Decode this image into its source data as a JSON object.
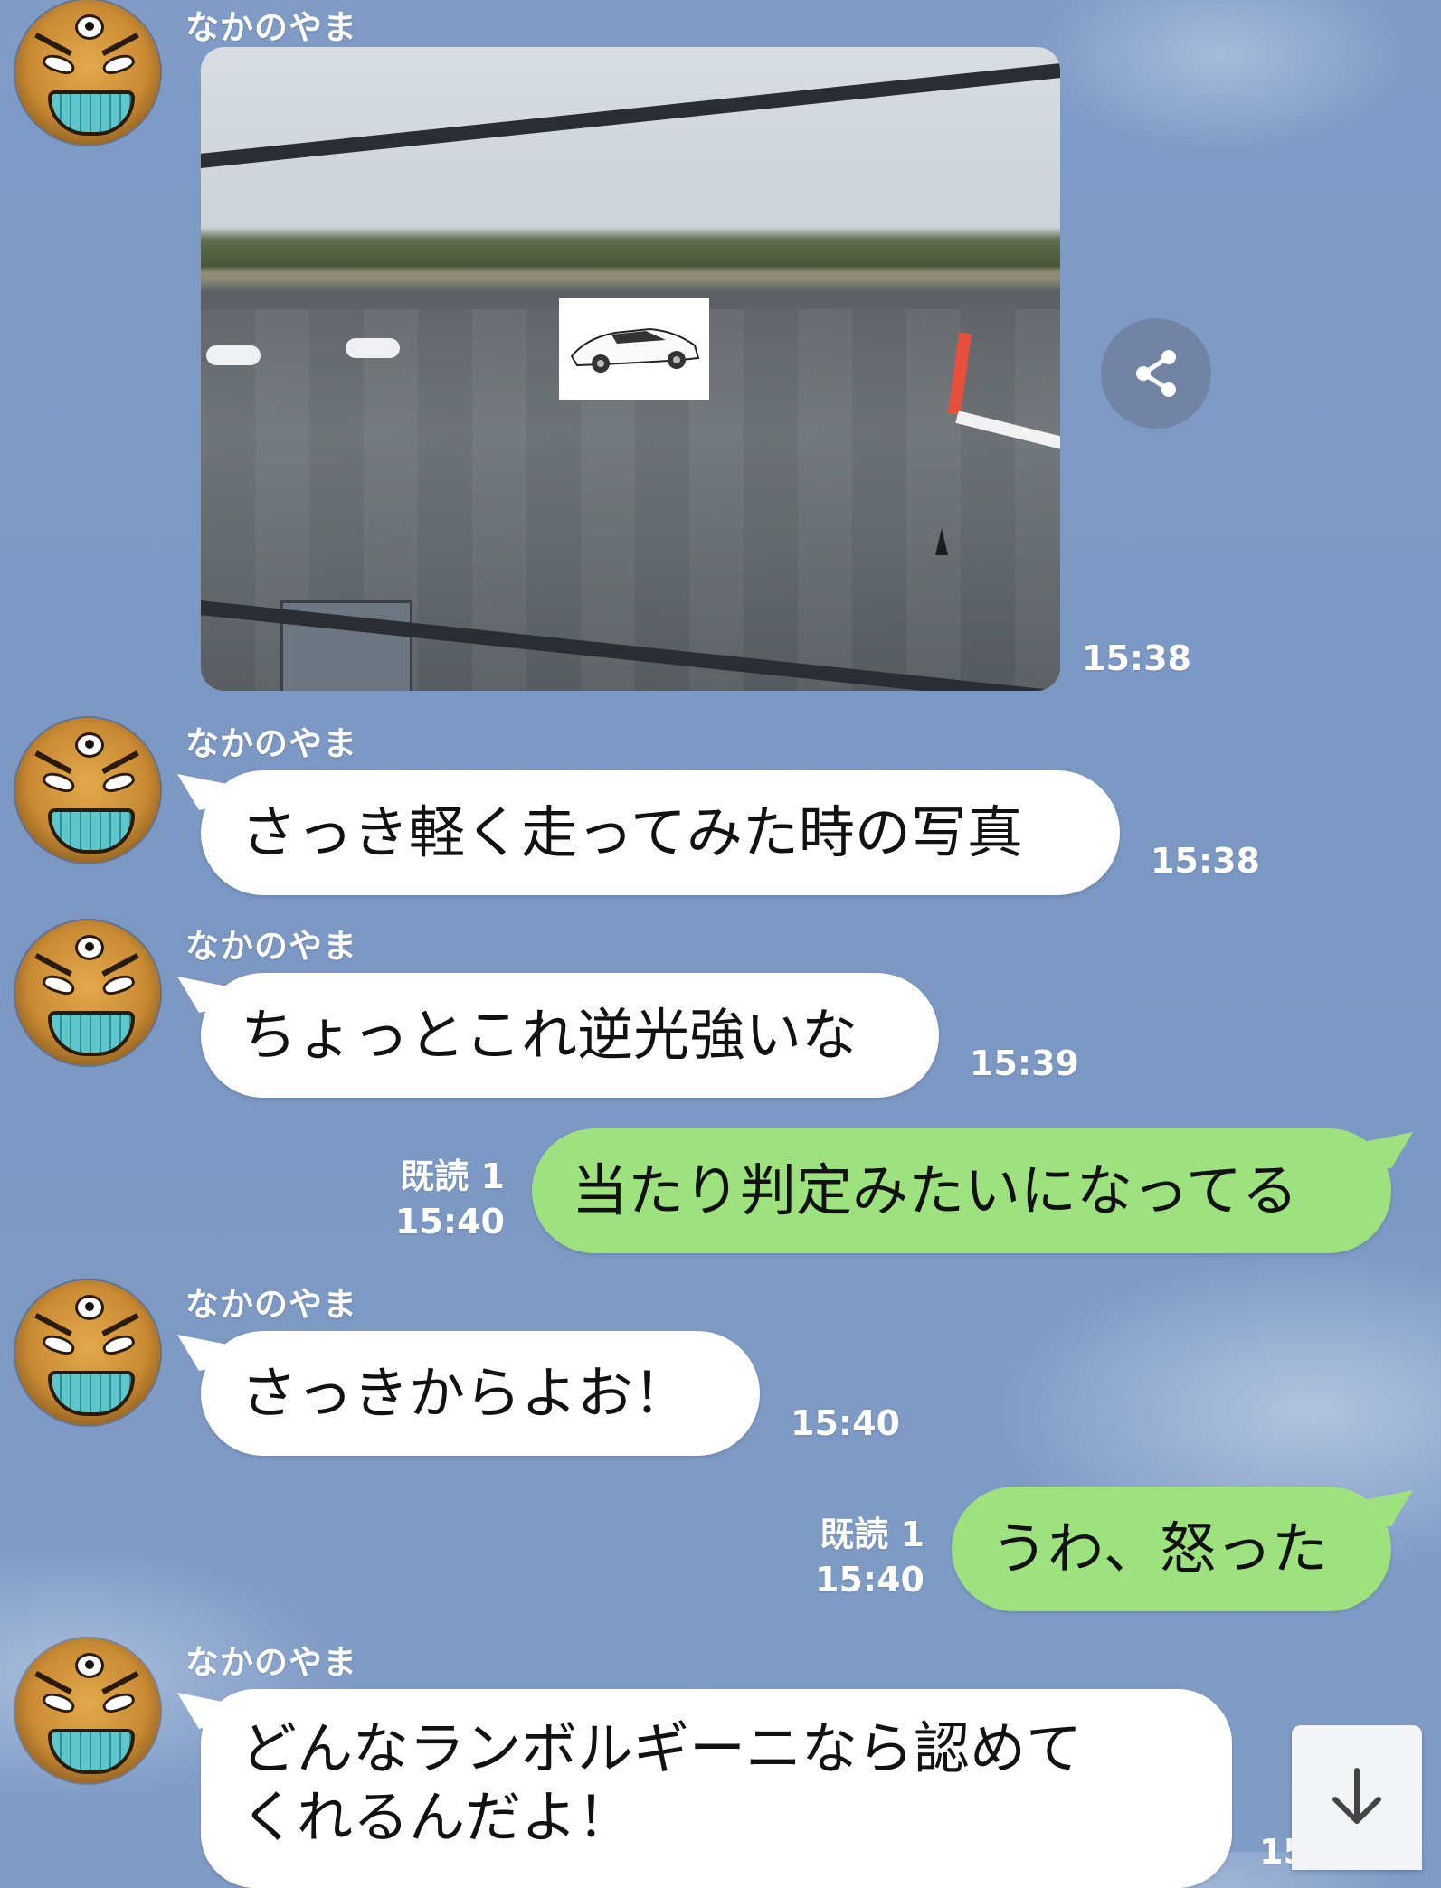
{
  "contact_name": "なかのやま",
  "messages": [
    {
      "id": "m1",
      "type": "image",
      "sender": "なかのやま",
      "time": "15:38",
      "image_desc_icon": "car-photo"
    },
    {
      "id": "m2",
      "type": "text",
      "sender": "なかのやま",
      "text": "さっき軽く走ってみた時の写真",
      "time": "15:38"
    },
    {
      "id": "m3",
      "type": "text",
      "sender": "なかのやま",
      "text": "ちょっとこれ逆光強いな",
      "time": "15:39"
    },
    {
      "id": "m4",
      "type": "text",
      "sender": "me",
      "text": "当たり判定みたいになってる",
      "read": "既読 1",
      "time": "15:40"
    },
    {
      "id": "m5",
      "type": "text",
      "sender": "なかのやま",
      "text": "さっきからよお！",
      "time": "15:40"
    },
    {
      "id": "m6",
      "type": "text",
      "sender": "me",
      "text": "うわ、怒った",
      "read": "既読 1",
      "time": "15:40"
    },
    {
      "id": "m7",
      "type": "text",
      "sender": "なかのやま",
      "text_line1": "どんなランボルギーニなら認めて",
      "text_line2": "くれるんだよ！",
      "time": "15:40"
    }
  ],
  "icons": {
    "share": "share-icon",
    "scroll_down": "arrow-down-icon"
  },
  "colors": {
    "background": "#7f9bc6",
    "incoming_bubble": "#ffffff",
    "outgoing_bubble": "#9ee27f",
    "meta_text": "#ffffff"
  }
}
